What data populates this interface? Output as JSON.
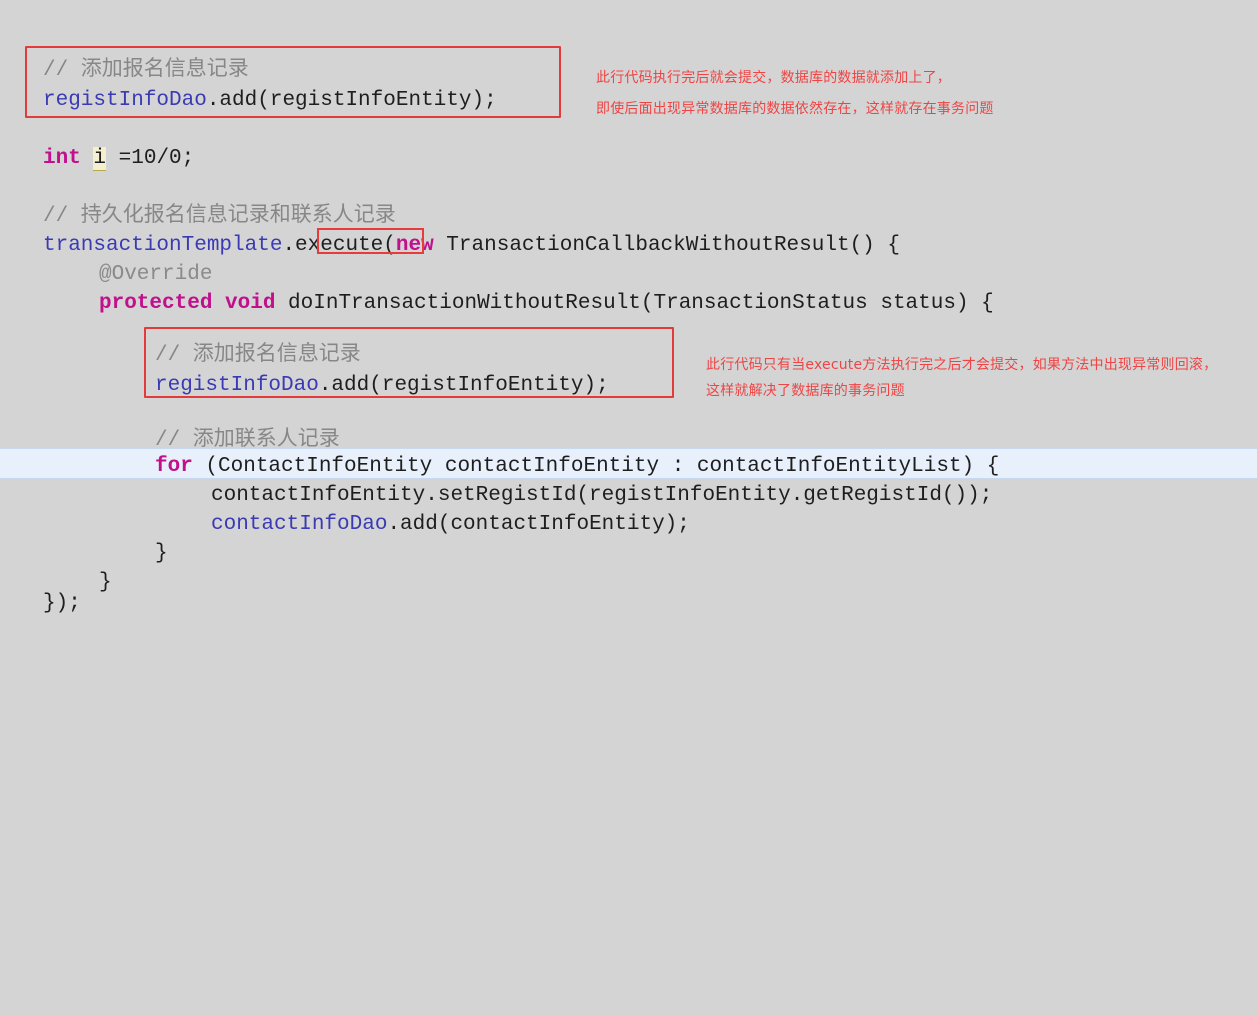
{
  "editor": {
    "background_color": "#d4d4d4",
    "highlight_color": "#e8f0fc",
    "comment_color": "#878787",
    "identifier_color": "#3a3ab4",
    "keyword_color": "#c0108c",
    "annotation_color": "#ef4444",
    "callout_border_color": "#e23b3b"
  },
  "code": {
    "line1_comment": "// 添加报名信息记录",
    "line2_ident": "registInfoDao",
    "line2_rest": ".add(registInfoEntity);",
    "line4_kw": "int",
    "line4_var": "i",
    "line4_rest": " =10/0;",
    "line6_comment": "// 持久化报名信息记录和联系人记录",
    "line7_ident": "transactionTemplate",
    "line7_execute": ".execute",
    "line7_paren": "(",
    "line7_new": "new",
    "line7_rest": " TransactionCallbackWithoutResult() {",
    "line8_override": "@Override",
    "line9_kw": "protected void",
    "line9_rest": " doInTransactionWithoutResult(TransactionStatus status) {",
    "line11_comment": "// 添加报名信息记录",
    "line12_ident": "registInfoDao",
    "line12_rest": ".add(registInfoEntity);",
    "line14_comment": "// 添加联系人记录",
    "line15_kw": "for",
    "line15_rest": " (ContactInfoEntity contactInfoEntity : contactInfoEntityList) {",
    "line16_text": "contactInfoEntity.setRegistId(registInfoEntity.getRegistId());",
    "line17_ident": "contactInfoDao",
    "line17_rest": ".add(contactInfoEntity);",
    "line18_brace": "}",
    "line19_brace": "}",
    "line20_brace": "});"
  },
  "annotations": {
    "note1_line1": "此行代码执行完后就会提交，数据库的数据就添加上了，",
    "note1_line2": "即使后面出现异常数据库的数据依然存在，这样就存在事务问题",
    "note2_line1": "此行代码只有当execute方法执行完之后才会提交，如果方法中出现异常则回滚，",
    "note2_line2": "这样就解决了数据库的事务问题"
  }
}
